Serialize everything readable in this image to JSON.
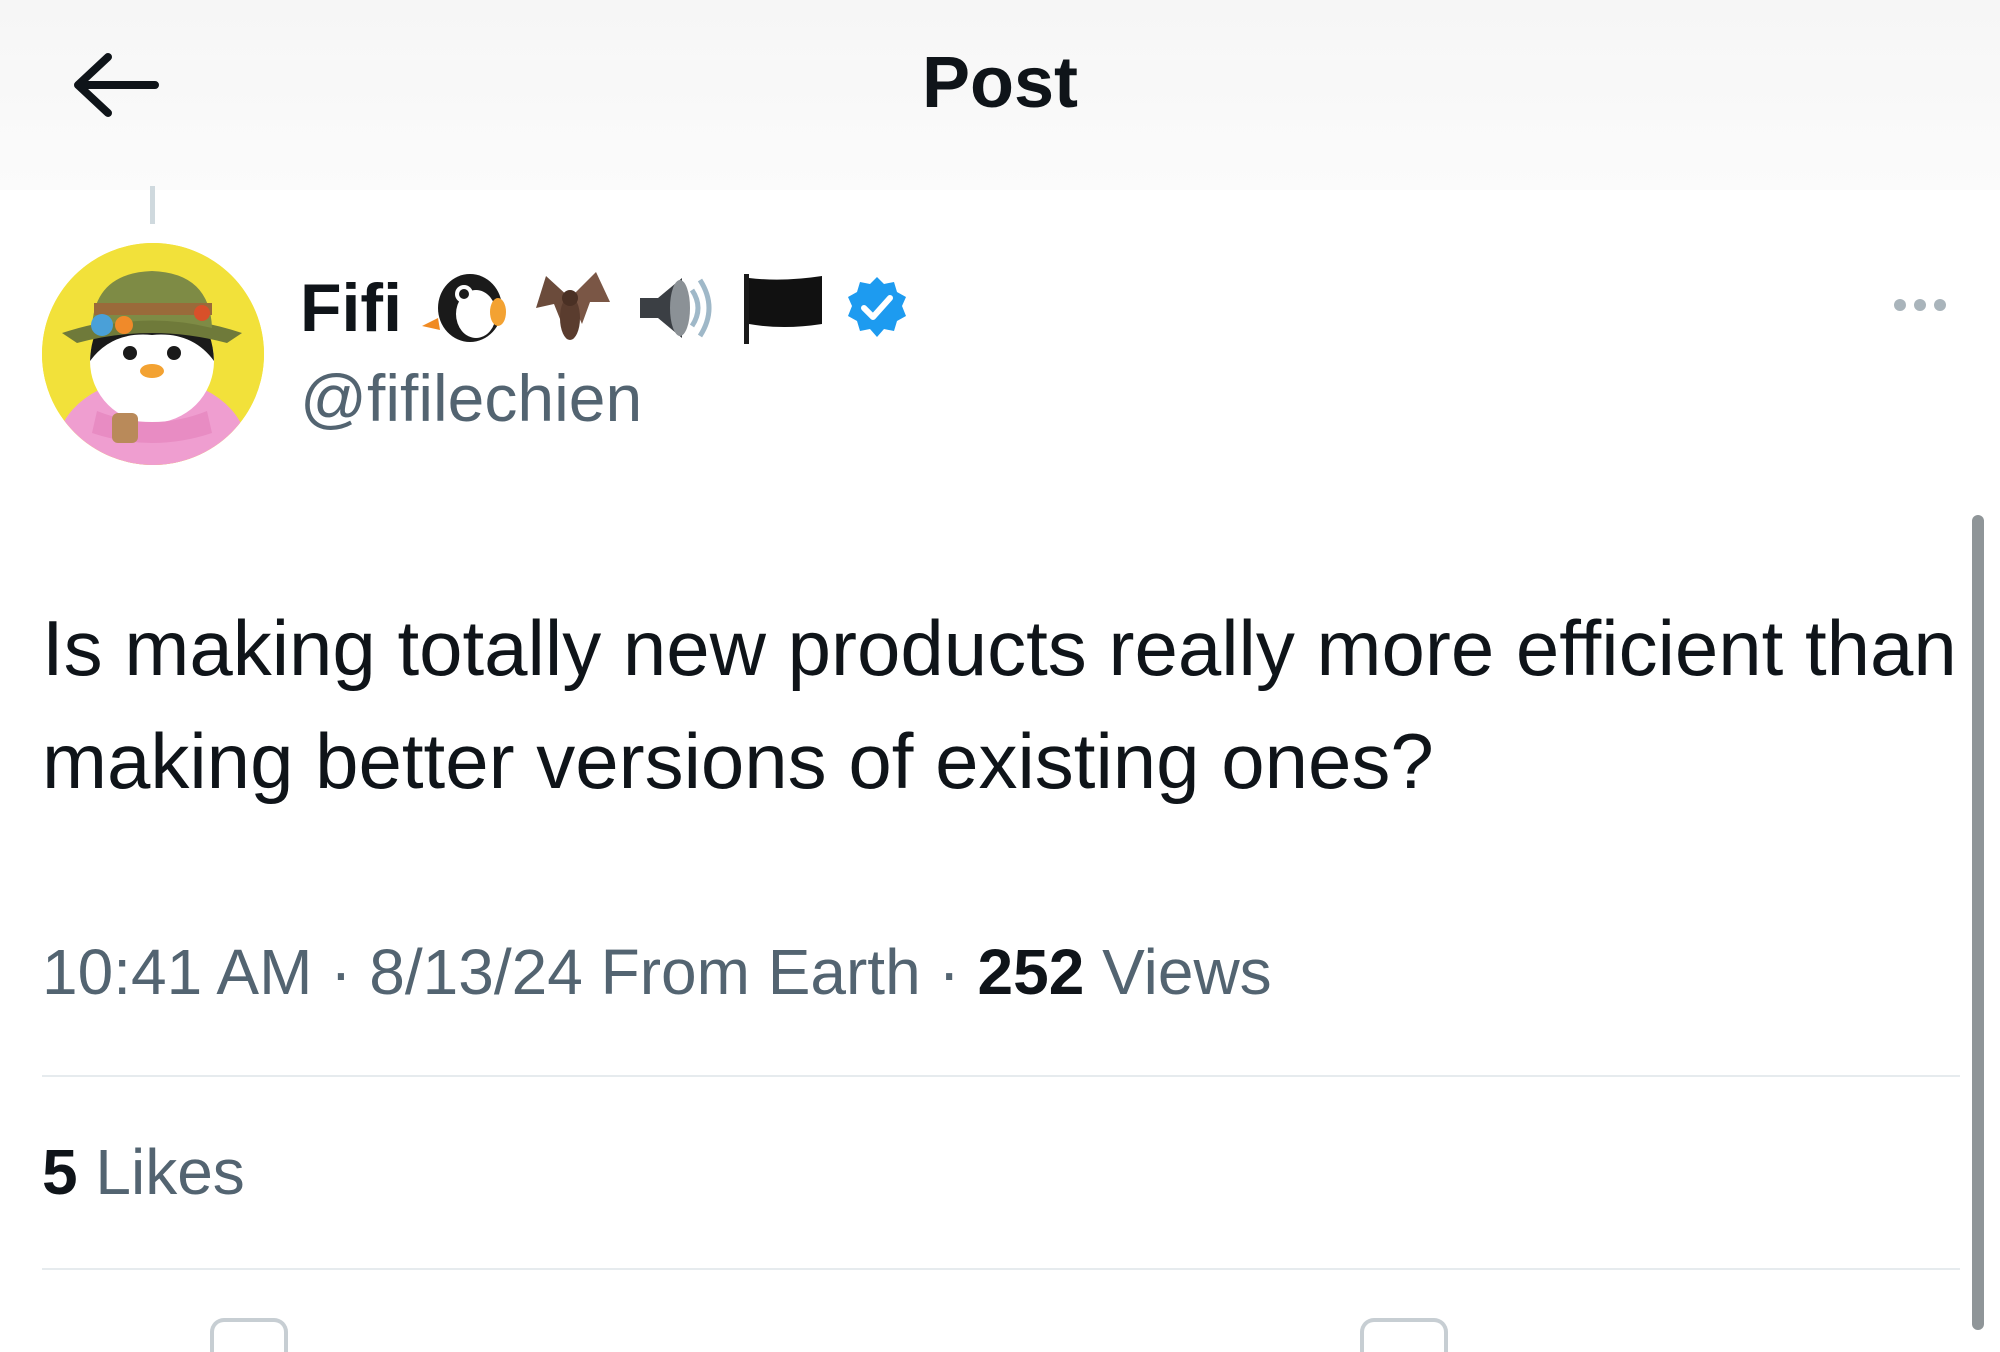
{
  "header": {
    "title": "Post",
    "back_icon": "arrow-left-icon"
  },
  "author": {
    "display_name": "Fifi",
    "handle": "@fifilechien",
    "name_emojis": [
      "penguin-icon",
      "bat-icon",
      "speaker-icon",
      "black-flag-icon"
    ],
    "verified": true,
    "verified_color": "#1d9bf0",
    "avatar_icon": "penguin-avatar"
  },
  "post": {
    "text": "Is making totally new products really more efficient than making better versions of existing ones?",
    "time": "10:41 AM",
    "date": "8/13/24",
    "location": "From Earth",
    "views_count": "252",
    "views_label": "Views",
    "likes_count": "5",
    "likes_label": "Likes"
  },
  "colors": {
    "text_primary": "#0f1419",
    "text_secondary": "#536471",
    "divider": "#e6ebee"
  }
}
